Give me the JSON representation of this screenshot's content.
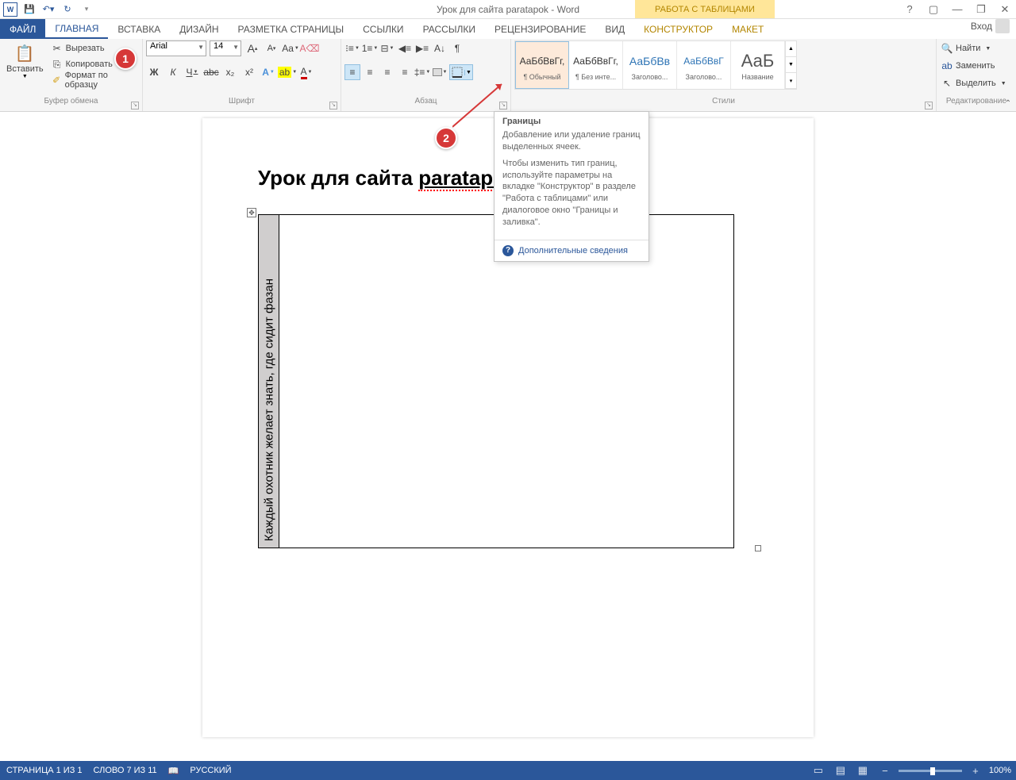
{
  "title": "Урок для сайта paratapok - Word",
  "tableTools": "РАБОТА С ТАБЛИЦАМИ",
  "tabs": {
    "file": "ФАЙЛ",
    "home": "ГЛАВНАЯ",
    "insert": "ВСТАВКА",
    "design": "ДИЗАЙН",
    "layout": "РАЗМЕТКА СТРАНИЦЫ",
    "references": "ССЫЛКИ",
    "mailings": "РАССЫЛКИ",
    "review": "РЕЦЕНЗИРОВАНИЕ",
    "view": "ВИД",
    "tableDesign": "КОНСТРУКТОР",
    "tableLayout": "МАКЕТ",
    "signin": "Вход"
  },
  "clipboard": {
    "paste": "Вставить",
    "cut": "Вырезать",
    "copy": "Копировать",
    "formatPainter": "Формат по образцу",
    "group": "Буфер обмена"
  },
  "font": {
    "name": "Arial",
    "size": "14",
    "group": "Шрифт",
    "case": "Aa",
    "bold": "Ж",
    "italic": "К",
    "underline": "Ч",
    "strike": "abc",
    "sub": "x₂",
    "sup": "x²"
  },
  "paragraph": {
    "group": "Абзац"
  },
  "styles": {
    "group": "Стили",
    "items": [
      {
        "preview": "АаБбВвГг,",
        "name": "¶ Обычный",
        "selected": true
      },
      {
        "preview": "АаБбВвГг,",
        "name": "¶ Без инте..."
      },
      {
        "preview": "АаБбВв",
        "name": "Заголово...",
        "blue": true
      },
      {
        "preview": "АаБбВвГ",
        "name": "Заголово...",
        "blue": true
      },
      {
        "preview": "АаБ",
        "name": "Название",
        "big": true
      }
    ]
  },
  "editing": {
    "find": "Найти",
    "replace": "Заменить",
    "select": "Выделить",
    "group": "Редактирование"
  },
  "tooltip": {
    "title": "Границы",
    "line1": "Добавление или удаление границ выделенных ячеек.",
    "line2": "Чтобы изменить тип границ, используйте параметры на вкладке \"Конструктор\" в разделе \"Работа с таблицами\" или диалоговое окно \"Границы и заливка\".",
    "more": "Дополнительные сведения"
  },
  "document": {
    "headingPrefix": "Урок для сайта ",
    "headingLink": "paratapok",
    "cellText": "Каждый охотник желает знать, где сидит фазан"
  },
  "status": {
    "page": "СТРАНИЦА 1 ИЗ 1",
    "words": "СЛОВО 7 ИЗ 11",
    "lang": "РУССКИЙ",
    "zoom": "100%"
  },
  "callouts": {
    "one": "1",
    "two": "2"
  }
}
